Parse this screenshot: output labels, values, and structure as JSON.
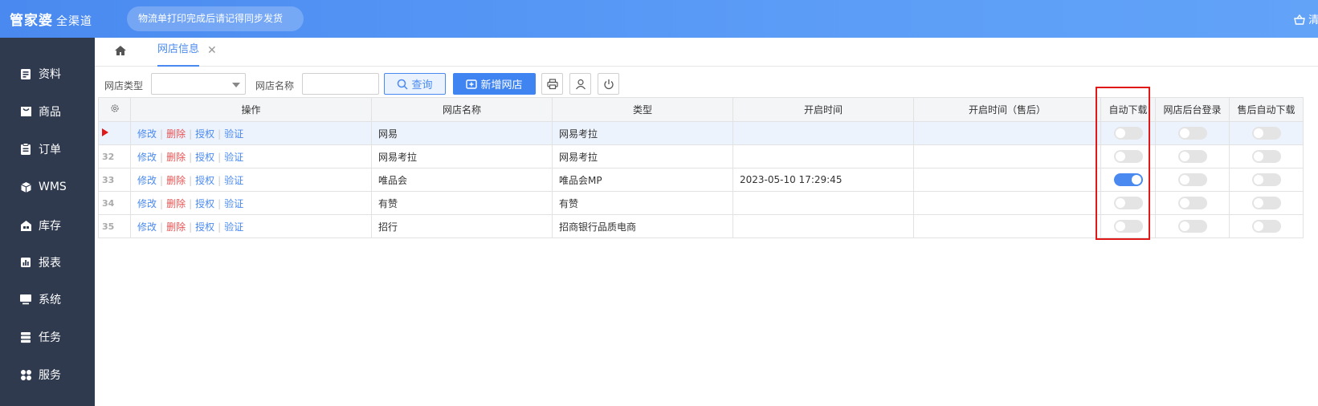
{
  "header": {
    "logo_main": "管家婆",
    "logo_sub": "全渠道",
    "notice": "物流单打印完成后请记得同步发货",
    "right_text": "清"
  },
  "sidebar": {
    "items": [
      {
        "label": "资料",
        "icon": "document-icon"
      },
      {
        "label": "商品",
        "icon": "goods-icon"
      },
      {
        "label": "订单",
        "icon": "clipboard-icon"
      },
      {
        "label": "WMS",
        "icon": "cube-icon"
      },
      {
        "label": "库存",
        "icon": "warehouse-icon"
      },
      {
        "label": "报表",
        "icon": "chart-icon"
      },
      {
        "label": "系统",
        "icon": "monitor-icon"
      },
      {
        "label": "任务",
        "icon": "server-icon"
      },
      {
        "label": "服务",
        "icon": "apps-icon"
      }
    ]
  },
  "tabs": {
    "active_label": "网店信息"
  },
  "toolbar": {
    "type_label": "网店类型",
    "type_value": "",
    "name_label": "网店名称",
    "name_value": "",
    "query_label": "查询",
    "add_label": "新增网店"
  },
  "table": {
    "headers": [
      "操作",
      "网店名称",
      "类型",
      "开启时间",
      "开启时间（售后）",
      "自动下载",
      "网店后台登录",
      "售后自动下载"
    ],
    "ops": {
      "edit": "修改",
      "delete": "删除",
      "auth": "授权",
      "verify": "验证"
    },
    "rows": [
      {
        "no": "",
        "name": "网易",
        "type": "网易考拉",
        "open_time": "",
        "open_time_after": "",
        "auto_download": false,
        "backend_login": false,
        "after_auto_download": false,
        "selected": true
      },
      {
        "no": "32",
        "name": "网易考拉",
        "type": "网易考拉",
        "open_time": "",
        "open_time_after": "",
        "auto_download": false,
        "backend_login": false,
        "after_auto_download": false,
        "selected": false
      },
      {
        "no": "33",
        "name": "唯品会",
        "type": "唯品会MP",
        "open_time": "2023-05-10 17:29:45",
        "open_time_after": "",
        "auto_download": true,
        "backend_login": false,
        "after_auto_download": false,
        "selected": false
      },
      {
        "no": "34",
        "name": "有赞",
        "type": "有赞",
        "open_time": "",
        "open_time_after": "",
        "auto_download": false,
        "backend_login": false,
        "after_auto_download": false,
        "selected": false
      },
      {
        "no": "35",
        "name": "招行",
        "type": "招商银行品质电商",
        "open_time": "",
        "open_time_after": "",
        "auto_download": false,
        "backend_login": false,
        "after_auto_download": false,
        "selected": false
      }
    ]
  },
  "colors": {
    "accent": "#4a8af0",
    "sidebar": "#2f3a4f",
    "highlight": "#e01818"
  }
}
